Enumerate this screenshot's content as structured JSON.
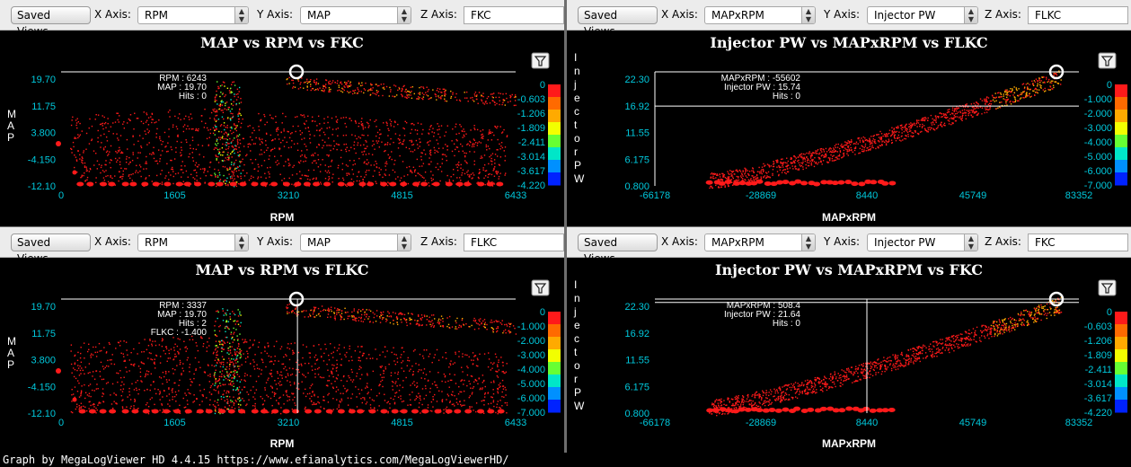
{
  "toolbar_labels": {
    "saved_views": "Saved Views",
    "x_axis": "X Axis:",
    "y_axis": "Y Axis:",
    "z_axis": "Z Axis:"
  },
  "footer": "Graph by MegaLogViewer HD 4.4.15 https://www.efianalytics.com/MegaLogViewerHD/",
  "colors": {
    "accent_cyan": "#00c8dc",
    "data_red": "#ff1a1a",
    "background": "#000000"
  },
  "panels": [
    {
      "x_axis": "RPM",
      "y_axis": "MAP",
      "z_axis": "FKC",
      "title": "MAP vs RPM vs FKC",
      "xlabel": "RPM",
      "ylabel": "MAP",
      "x_ticks": [
        "0",
        "1605",
        "3210",
        "4815",
        "6433"
      ],
      "y_ticks": [
        "19.70",
        "11.75",
        "3.800",
        "-4.150",
        "-12.10"
      ],
      "z_ticks": [
        "0",
        "-0.603",
        "-1.206",
        "-1.809",
        "-2.411",
        "-3.014",
        "-3.617",
        "-4.220"
      ],
      "readout": [
        "RPM : 6243",
        "MAP : 19.70",
        "Hits : 0"
      ],
      "cursor": {
        "x": 0.0,
        "y": 1.0,
        "vline": false
      },
      "shape": "rpm"
    },
    {
      "x_axis": "MAPxRPM",
      "y_axis": "Injector PW",
      "z_axis": "FLKC",
      "title": "Injector PW vs MAPxRPM vs FLKC",
      "xlabel": "MAPxRPM",
      "ylabel": "Injector PW",
      "x_ticks": [
        "-66178",
        "-28869",
        "8440",
        "45749",
        "83352"
      ],
      "y_ticks": [
        "22.30",
        "16.92",
        "11.55",
        "6.175",
        "0.800"
      ],
      "z_ticks": [
        "0",
        "-1.000",
        "-2.000",
        "-3.000",
        "-4.000",
        "-5.000",
        "-6.000",
        "-7.000"
      ],
      "readout": [
        "MAPxRPM : -55602",
        "Injector PW : 15.74",
        "Hits : 0"
      ],
      "cursor": {
        "x": 0.0,
        "y": 0.7,
        "vline": true
      },
      "shape": "pw"
    },
    {
      "x_axis": "RPM",
      "y_axis": "MAP",
      "z_axis": "FLKC",
      "title": "MAP vs RPM vs FLKC",
      "xlabel": "RPM",
      "ylabel": "MAP",
      "x_ticks": [
        "0",
        "1605",
        "3210",
        "4815",
        "6433"
      ],
      "y_ticks": [
        "19.70",
        "11.75",
        "3.800",
        "-4.150",
        "-12.10"
      ],
      "z_ticks": [
        "0",
        "-1.000",
        "-2.000",
        "-3.000",
        "-4.000",
        "-5.000",
        "-6.000",
        "-7.000"
      ],
      "readout": [
        "RPM : 3337",
        "MAP : 19.70",
        "Hits : 2",
        "FLKC : -1.400"
      ],
      "cursor": {
        "x": 0.52,
        "y": 1.0,
        "vline": true
      },
      "shape": "rpm"
    },
    {
      "x_axis": "MAPxRPM",
      "y_axis": "Injector PW",
      "z_axis": "FKC",
      "title": "Injector PW vs MAPxRPM vs FKC",
      "xlabel": "MAPxRPM",
      "ylabel": "Injector PW",
      "x_ticks": [
        "-66178",
        "-28869",
        "8440",
        "45749",
        "83352"
      ],
      "y_ticks": [
        "22.30",
        "16.92",
        "11.55",
        "6.175",
        "0.800"
      ],
      "z_ticks": [
        "0",
        "-0.603",
        "-1.206",
        "-1.809",
        "-2.411",
        "-3.014",
        "-3.617",
        "-4.220"
      ],
      "readout": [
        "MAPxRPM : 508.4",
        "Injector PW : 21.64",
        "Hits : 0"
      ],
      "cursor": {
        "x": 0.5,
        "y": 0.97,
        "vline": true
      },
      "shape": "pw"
    }
  ]
}
